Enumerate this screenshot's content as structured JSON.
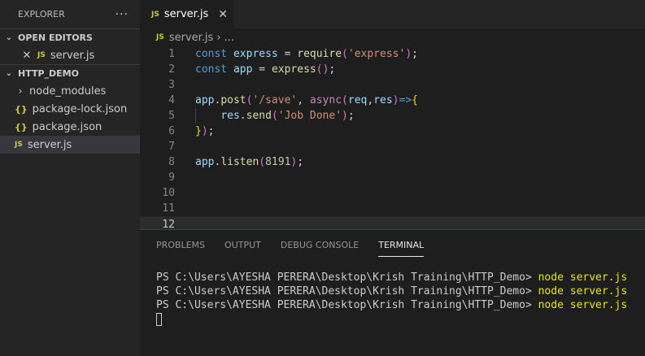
{
  "sidebar": {
    "title": "EXPLORER",
    "more_icon": "ellipsis-icon",
    "open_editors": {
      "label": "OPEN EDITORS",
      "items": [
        {
          "icon": "JS",
          "label": "server.js"
        }
      ]
    },
    "project": {
      "label": "HTTP_DEMO",
      "items": [
        {
          "icon": "chevron-right-icon",
          "label": "node_modules"
        },
        {
          "icon": "{}",
          "label": "package-lock.json"
        },
        {
          "icon": "{}",
          "label": "package.json"
        },
        {
          "icon": "JS",
          "label": "server.js"
        }
      ]
    }
  },
  "tab": {
    "icon": "JS",
    "label": "server.js"
  },
  "breadcrumb": {
    "icon": "JS",
    "file": "server.js",
    "separator": "›",
    "rest": "..."
  },
  "editor": {
    "line_numbers": [
      "1",
      "2",
      "3",
      "4",
      "5",
      "6",
      "7",
      "8",
      "9",
      "10",
      "11",
      "12"
    ],
    "current_line": "12",
    "lines": [
      "const express = require('express');",
      "const app = express();",
      "",
      "app.post('/save', async(req,res)=>{",
      "    res.send('Job Done');",
      "});",
      "",
      "app.listen(8191);",
      "",
      "",
      "",
      ""
    ]
  },
  "panel": {
    "tabs": [
      "PROBLEMS",
      "OUTPUT",
      "DEBUG CONSOLE",
      "TERMINAL"
    ],
    "active_tab": "TERMINAL",
    "terminal": {
      "prompt": "PS C:\\Users\\AYESHA PERERA\\Desktop\\Krish Training\\HTTP_Demo> ",
      "commands": [
        "node server.js",
        "node server.js",
        "node server.js"
      ]
    }
  }
}
